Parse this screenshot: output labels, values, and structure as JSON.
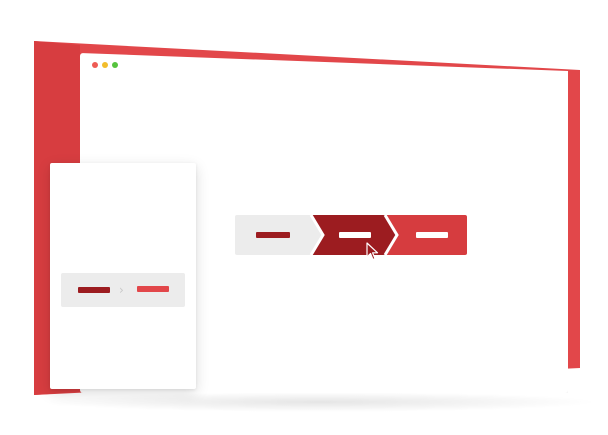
{
  "colors": {
    "brand_red": "#e2474a",
    "dark_red": "#9c1c20",
    "mid_red": "#d63c3f",
    "muted_bg": "#ececec",
    "dot_red": "#ee5b54",
    "dot_yellow": "#f2bd2c",
    "dot_green": "#56c33e"
  },
  "browser": {
    "window_controls": [
      "close-dot",
      "minimize-dot",
      "maximize-dot"
    ]
  },
  "breadcrumb_flow": {
    "steps": [
      {
        "state": "inactive",
        "bar_color": "#9c1c20"
      },
      {
        "state": "active",
        "bar_color": "#ffffff"
      },
      {
        "state": "next",
        "bar_color": "#ffffff"
      }
    ],
    "cursor": "pointer-arrow"
  },
  "side_panel": {
    "mini_flow": {
      "steps": [
        {
          "bar_color": "#9c1c20"
        },
        {
          "bar_color": "#e2474a"
        }
      ],
      "separator_icon": "chevron-right-icon"
    }
  }
}
